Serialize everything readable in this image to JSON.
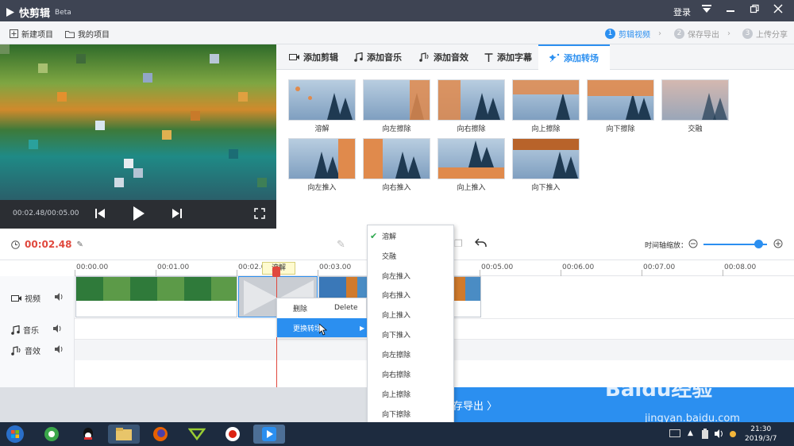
{
  "app": {
    "title": "快剪辑",
    "badge": "Beta",
    "login": "登录"
  },
  "menu": {
    "new_project": "新建项目",
    "my_projects": "我的项目"
  },
  "steps": [
    {
      "num": "1",
      "label": "剪辑视频"
    },
    {
      "num": "2",
      "label": "保存导出"
    },
    {
      "num": "3",
      "label": "上传分享"
    }
  ],
  "preview": {
    "timecode": "00:02.48/00:05.00"
  },
  "tabs": [
    {
      "label": "添加剪辑",
      "icon": "film-icon"
    },
    {
      "label": "添加音乐",
      "icon": "music-icon"
    },
    {
      "label": "添加音效",
      "icon": "sound-effect-icon"
    },
    {
      "label": "添加字幕",
      "icon": "text-icon"
    },
    {
      "label": "添加转场",
      "icon": "transition-icon"
    }
  ],
  "transitions": [
    "溶解",
    "向左擦除",
    "向右擦除",
    "向上擦除",
    "向下擦除",
    "交融",
    "向左推入",
    "向右推入",
    "向上推入",
    "向下推入"
  ],
  "editor": {
    "current_time": "00:02.48",
    "zoom_label": "时间轴缩放："
  },
  "ruler": [
    "00:00.00",
    "00:01.00",
    "00:02.0",
    "00:03.00",
    "00:05.00",
    "00:06.00",
    "00:07.00",
    "00:08.00"
  ],
  "tracks": {
    "video": "视频",
    "music": "音乐",
    "sfx": "音效"
  },
  "transition_tag": "溶解",
  "context_menu": {
    "delete": "删除",
    "delete_key": "Delete",
    "change_transition": "更换转场"
  },
  "submenu": {
    "items": [
      "溶解",
      "交融",
      "向左推入",
      "向右推入",
      "向上推入",
      "向下推入",
      "向左擦除",
      "向右擦除",
      "向上擦除",
      "向下擦除"
    ]
  },
  "export": {
    "label": "存导出 〉"
  },
  "clock": {
    "time": "21:30",
    "date": "2019/3/7"
  },
  "watermark": {
    "brand": "Baidu经验",
    "url": "jingyan.baidu.com"
  },
  "colors": {
    "accent": "#2b8ff0",
    "time_red": "#e0483d",
    "titlebar": "#3e4453"
  }
}
